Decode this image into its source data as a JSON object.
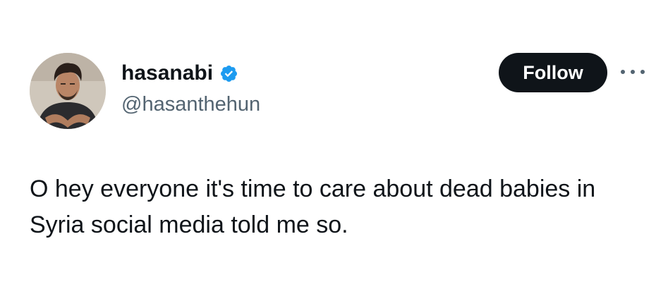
{
  "author": {
    "display_name": "hasanabi",
    "handle": "@hasanthehun",
    "verified": true,
    "verified_color": "#1d9bf0"
  },
  "actions": {
    "follow_label": "Follow",
    "more_icon": "more-horizontal-icon"
  },
  "tweet": {
    "text": "O hey everyone it's time to care about dead babies in Syria social media told me so."
  },
  "colors": {
    "text_primary": "#0f1419",
    "text_secondary": "#536471",
    "button_bg": "#0f1419",
    "button_text": "#ffffff"
  }
}
